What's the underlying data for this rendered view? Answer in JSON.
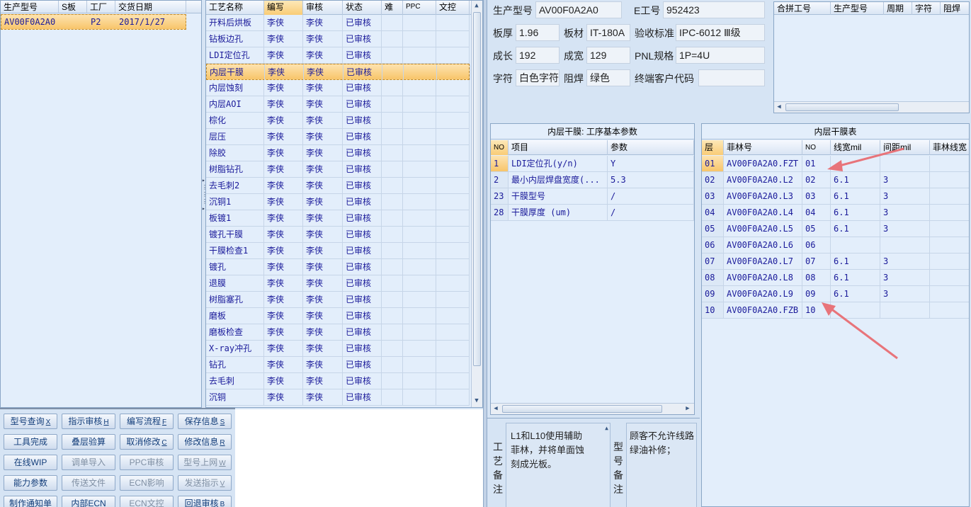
{
  "orders": {
    "columns": [
      "生产型号",
      "S板",
      "工厂",
      "交货日期"
    ],
    "rows": [
      [
        "AV00F0A2A0",
        "",
        "P2",
        "2017/1/27"
      ]
    ]
  },
  "processes": {
    "columns": [
      "工艺名称",
      "编写",
      "审核",
      "状态",
      "难",
      "PPC",
      "文控"
    ],
    "rows": [
      [
        "开料后烘板",
        "李侠",
        "李侠",
        "已审核"
      ],
      [
        "钻板边孔",
        "李侠",
        "李侠",
        "已审核"
      ],
      [
        "LDI定位孔",
        "李侠",
        "李侠",
        "已审核"
      ],
      [
        "内层干膜",
        "李侠",
        "李侠",
        "已审核"
      ],
      [
        "内层蚀刻",
        "李侠",
        "李侠",
        "已审核"
      ],
      [
        "内层AOI",
        "李侠",
        "李侠",
        "已审核"
      ],
      [
        "棕化",
        "李侠",
        "李侠",
        "已审核"
      ],
      [
        "层压",
        "李侠",
        "李侠",
        "已审核"
      ],
      [
        "除胶",
        "李侠",
        "李侠",
        "已审核"
      ],
      [
        "树脂钻孔",
        "李侠",
        "李侠",
        "已审核"
      ],
      [
        "去毛刺2",
        "李侠",
        "李侠",
        "已审核"
      ],
      [
        "沉铜1",
        "李侠",
        "李侠",
        "已审核"
      ],
      [
        "板镀1",
        "李侠",
        "李侠",
        "已审核"
      ],
      [
        "镀孔干膜",
        "李侠",
        "李侠",
        "已审核"
      ],
      [
        "干膜检查1",
        "李侠",
        "李侠",
        "已审核"
      ],
      [
        "镀孔",
        "李侠",
        "李侠",
        "已审核"
      ],
      [
        "退膜",
        "李侠",
        "李侠",
        "已审核"
      ],
      [
        "树脂塞孔",
        "李侠",
        "李侠",
        "已审核"
      ],
      [
        "磨板",
        "李侠",
        "李侠",
        "已审核"
      ],
      [
        "磨板检查",
        "李侠",
        "李侠",
        "已审核"
      ],
      [
        "X-ray冲孔",
        "李侠",
        "李侠",
        "已审核"
      ],
      [
        "钻孔",
        "李侠",
        "李侠",
        "已审核"
      ],
      [
        "去毛刺",
        "李侠",
        "李侠",
        "已审核"
      ],
      [
        "沉铜",
        "李侠",
        "李侠",
        "已审核"
      ]
    ]
  },
  "buttons": [
    [
      "型号查询",
      "X",
      false
    ],
    [
      "指示审核",
      "H",
      false
    ],
    [
      "编写流程",
      "F",
      false
    ],
    [
      "保存信息",
      "S",
      false
    ],
    [
      "工具完成",
      "",
      false
    ],
    [
      "叠层验算",
      "",
      false
    ],
    [
      "取消修改",
      "C",
      false
    ],
    [
      "修改信息",
      "R",
      false
    ],
    [
      "在线WIP",
      "",
      false
    ],
    [
      "调单导入",
      "",
      true
    ],
    [
      "PPC审核",
      "",
      true
    ],
    [
      "型号上网",
      "W",
      true
    ],
    [
      "能力参数",
      "",
      false
    ],
    [
      "传送文件",
      "",
      true
    ],
    [
      "ECN影响",
      "",
      true
    ],
    [
      "发送指示",
      "V",
      true
    ],
    [
      "制作通知单",
      "",
      false
    ],
    [
      "内部ECN",
      "",
      false
    ],
    [
      "ECN文控",
      "",
      true
    ],
    [
      "回退审核",
      "B",
      false
    ]
  ],
  "info": {
    "l_model": "生产型号",
    "v_model": "AV00F0A2A0",
    "l_ework": "E工号",
    "v_ework": "952423",
    "l_thick": "板厚",
    "v_thick": "1.96",
    "l_material": "板材",
    "v_material": "IT-180A",
    "l_standard": "验收标准",
    "v_standard": "IPC-6012 Ⅲ级",
    "l_length": "成长",
    "v_length": "192",
    "l_width": "成宽",
    "v_width": "129",
    "l_pnl": "PNL规格",
    "v_pnl": "1P=4U",
    "l_char": "字符",
    "v_char": "白色字符",
    "l_mask": "阻焊",
    "v_mask": "绿色",
    "l_customer": "终端客户代码",
    "v_customer": ""
  },
  "merge": {
    "columns": [
      "合拼工号",
      "生产型号",
      "周期",
      "字符",
      "阻焊"
    ]
  },
  "params": {
    "title": "内层干膜: 工序基本参数",
    "columns": [
      "NO",
      "项目",
      "参数"
    ],
    "rows": [
      [
        "1",
        "LDI定位孔(y/n)",
        "Y"
      ],
      [
        "2",
        "最小内层焊盘宽度(...",
        "5.3"
      ],
      [
        "23",
        "干膜型号",
        "/"
      ],
      [
        "28",
        "干膜厚度 (um)",
        "/"
      ]
    ]
  },
  "films": {
    "title": "内层干膜表",
    "columns": [
      "层",
      "菲林号",
      "NO",
      "线宽mil",
      "间距mil",
      "菲林线宽"
    ],
    "rows": [
      [
        "01",
        "AV00F0A2A0.FZT",
        "01",
        "",
        ""
      ],
      [
        "02",
        "AV00F0A2A0.L2",
        "02",
        "6.1",
        "3"
      ],
      [
        "03",
        "AV00F0A2A0.L3",
        "03",
        "6.1",
        "3"
      ],
      [
        "04",
        "AV00F0A2A0.L4",
        "04",
        "6.1",
        "3"
      ],
      [
        "05",
        "AV00F0A2A0.L5",
        "05",
        "6.1",
        "3"
      ],
      [
        "06",
        "AV00F0A2A0.L6",
        "06",
        "",
        ""
      ],
      [
        "07",
        "AV00F0A2A0.L7",
        "07",
        "6.1",
        "3"
      ],
      [
        "08",
        "AV00F0A2A0.L8",
        "08",
        "6.1",
        "3"
      ],
      [
        "09",
        "AV00F0A2A0.L9",
        "09",
        "6.1",
        "3"
      ],
      [
        "10",
        "AV00F0A2A0.FZB",
        "10",
        "",
        ""
      ]
    ]
  },
  "notes": {
    "process_label": "工艺备注",
    "process_text": "L1和L10使用辅助\n菲林，并将单面蚀\n刻成光板。",
    "model_label": "型号备注",
    "model_text": "顾客不允许线路\n绿油补修；"
  },
  "colors": {
    "annotation_arrow": "#e8747a",
    "selected_row": "#f8c56a"
  }
}
